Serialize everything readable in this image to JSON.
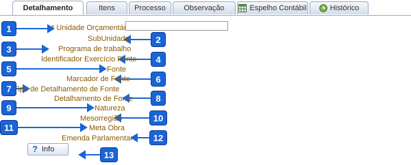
{
  "tabs": [
    {
      "label": "Detalhamento",
      "active": true,
      "icon": ""
    },
    {
      "label": "Itens",
      "active": false,
      "icon": ""
    },
    {
      "label": "Processo",
      "active": false,
      "icon": ""
    },
    {
      "label": "Observação",
      "active": false,
      "icon": ""
    },
    {
      "label": "Espelho Contábil",
      "active": false,
      "icon": "table-icon"
    },
    {
      "label": "Histórico",
      "active": false,
      "icon": "history-icon"
    }
  ],
  "fields": {
    "unidade_orcamentaria": {
      "label": "* Unidade Orçamentária",
      "value": ""
    },
    "subunidade": "SubUnidade",
    "programa_trabalho": "Programa de trabalho",
    "identificador_exercicio_fonte": "Identificador Exercício Fonte",
    "fonte": "Fonte",
    "marcador_fonte": "Marcador de Fonte",
    "tipo_detalhamento_fonte": "Tipo de Detalhamento de Fonte",
    "detalhamento_fonte": "Detalhamento de Fonte",
    "natureza": "Natureza",
    "mesorregiao": "Mesorregião",
    "meta_obra": "Meta Obra",
    "emenda_parlamentar": "Emenda Parlamentar"
  },
  "info_button": {
    "label": "Info"
  },
  "markers": [
    "1",
    "2",
    "3",
    "4",
    "5",
    "6",
    "7",
    "8",
    "9",
    "10",
    "11",
    "12",
    "13"
  ],
  "colors": {
    "marker": "#1a64d8",
    "label": "#8a5a00",
    "tab_border": "#9aa9c6"
  }
}
